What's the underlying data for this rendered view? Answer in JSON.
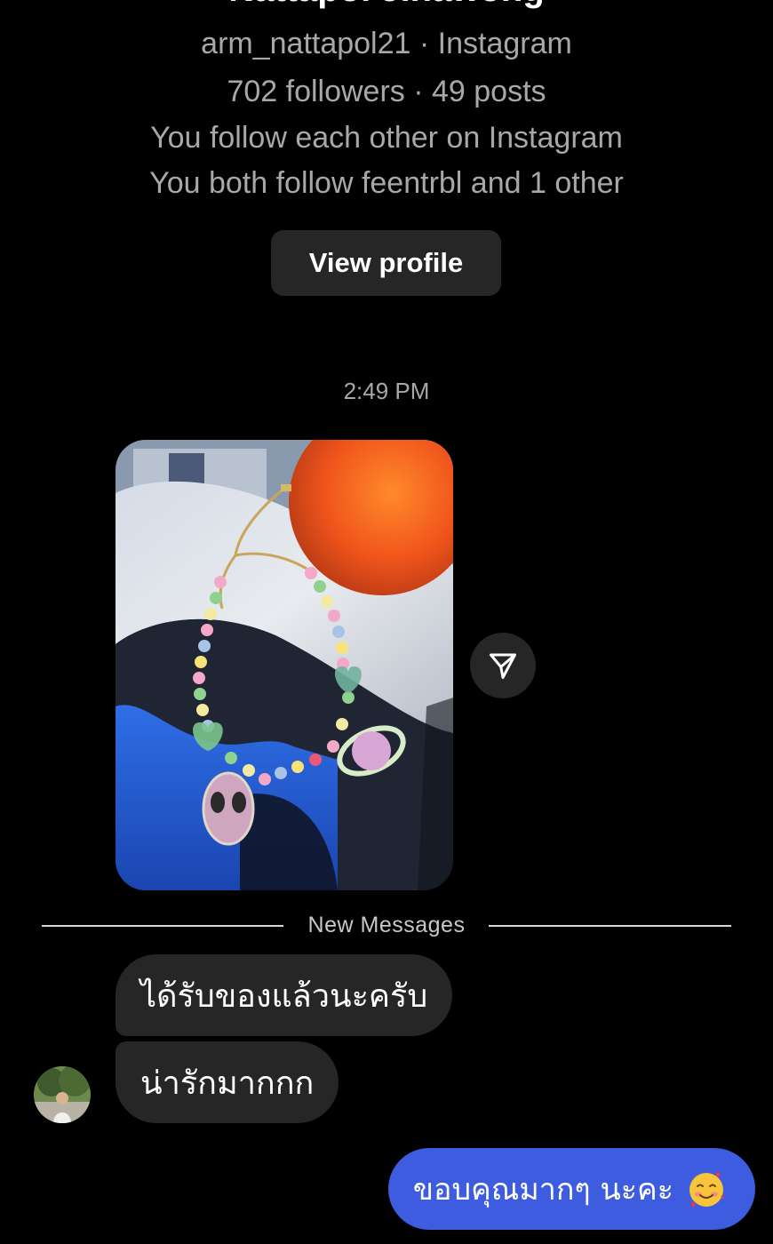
{
  "profile": {
    "display_name": "Nattapol Jinawong",
    "username_line": "arm_nattapol21 · Instagram",
    "stats_line": "702 followers · 49 posts",
    "mutual_follow_line": "You follow each other on Instagram",
    "mutual_friends_line": "You both follow feentrbl and 1 other",
    "view_profile_label": "View profile"
  },
  "thread": {
    "timestamp": "2:49 PM",
    "shared_photo_description": "bracelet",
    "share_icon": "paper-plane-icon",
    "new_messages_label": "New Messages",
    "incoming": [
      {
        "text": "ได้รับของแล้วนะครับ"
      },
      {
        "text": "น่ารักมากกก"
      }
    ],
    "outgoing": [
      {
        "text": "ขอบคุณมากๆ นะคะ",
        "emoji": "smiling-face-with-hearts"
      }
    ]
  },
  "colors": {
    "background": "#000000",
    "incoming_bubble": "#262626",
    "outgoing_bubble": "#3d5ce0",
    "secondary_text": "#a8a8a8"
  }
}
